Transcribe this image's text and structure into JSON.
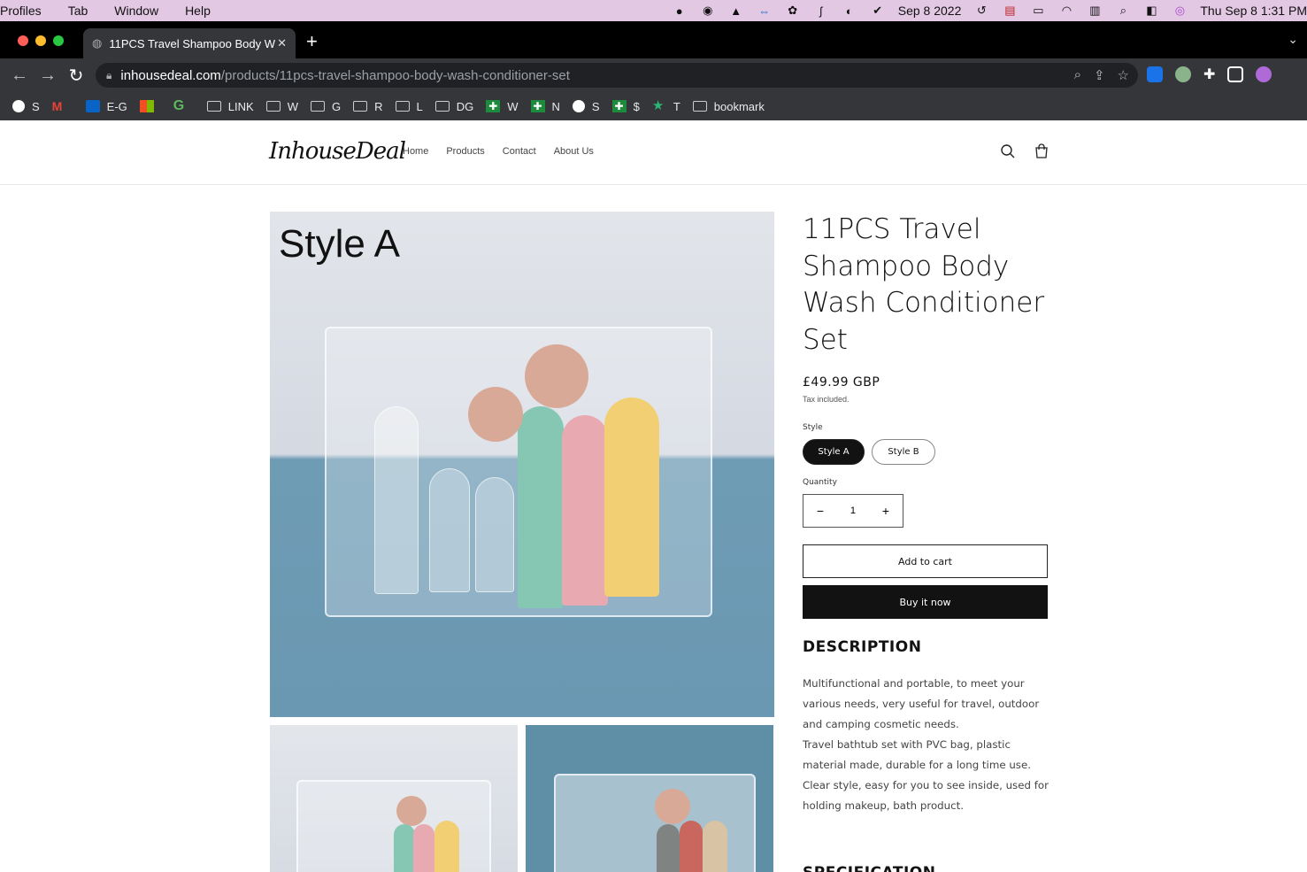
{
  "os_menu": {
    "items": [
      "Profiles",
      "Tab",
      "Window",
      "Help"
    ],
    "date_short": "Sep 8 2022",
    "clock": "Thu Sep 8  1:31 PM"
  },
  "browser": {
    "tab_title": "11PCS Travel Shampoo Body W",
    "url_host": "inhousedeal.com",
    "url_path": "/products/11pcs-travel-shampoo-body-wash-conditioner-set",
    "bookmarks": [
      {
        "label": "S",
        "icon": "globe-icon"
      },
      {
        "label": "",
        "icon": "gmail-icon"
      },
      {
        "label": "E-G",
        "icon": "outlook-icon"
      },
      {
        "label": "",
        "icon": "microsoft-icon"
      },
      {
        "label": "",
        "icon": "g-icon"
      },
      {
        "label": "LINK",
        "icon": "folder-icon"
      },
      {
        "label": "W",
        "icon": "folder-icon"
      },
      {
        "label": "G",
        "icon": "folder-icon"
      },
      {
        "label": "R",
        "icon": "folder-icon"
      },
      {
        "label": "L",
        "icon": "folder-icon"
      },
      {
        "label": "DG",
        "icon": "folder-icon"
      },
      {
        "label": "W",
        "icon": "green-cross-icon"
      },
      {
        "label": "N",
        "icon": "green-cross-icon"
      },
      {
        "label": "S",
        "icon": "globe-icon"
      },
      {
        "label": "$",
        "icon": "green-cross-icon"
      },
      {
        "label": "T",
        "icon": "star-icon"
      },
      {
        "label": "bookmark",
        "icon": "folder-icon"
      }
    ]
  },
  "site": {
    "logo": "InhouseDeal",
    "nav": [
      "Home",
      "Products",
      "Contact",
      "About Us"
    ]
  },
  "product": {
    "image_label": "Style A",
    "title": "11PCS Travel Shampoo Body Wash Conditioner Set",
    "price": "£49.99 GBP",
    "tax_note": "Tax included.",
    "style_label": "Style",
    "styles": [
      "Style A",
      "Style B"
    ],
    "selected_style": "Style A",
    "quantity_label": "Quantity",
    "quantity": "1",
    "add_to_cart": "Add to cart",
    "buy_now": "Buy it now",
    "description_heading": "DESCRIPTION",
    "description_lines": [
      "Multifunctional and portable, to meet your",
      "various needs, very useful for travel, outdoor",
      "and camping cosmetic needs.",
      "Travel bathtub set with PVC bag, plastic",
      "material made, durable for a long time use.",
      "Clear style, easy for you to see inside, used for",
      "holding makeup, bath product."
    ],
    "specification_heading": "SPECIFICATION"
  },
  "colors": {
    "accent": "#121212",
    "menubar": "#e3c8e4"
  }
}
